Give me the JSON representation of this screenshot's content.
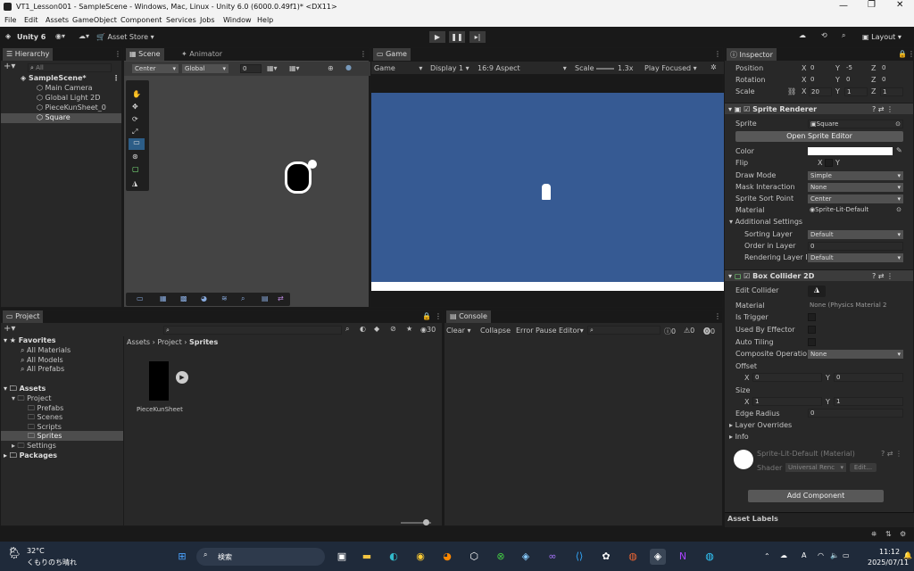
{
  "window": {
    "title": "VT1_Lesson001 - SampleScene - Windows, Mac, Linux - Unity 6.0 (6000.0.49f1)* <DX11>"
  },
  "menu": [
    "File",
    "Edit",
    "Assets",
    "GameObject",
    "Component",
    "Services",
    "Jobs",
    "Window",
    "Help"
  ],
  "toolbar": {
    "account": "Unity 6",
    "asset_store": "Asset Store",
    "layout": "Layout"
  },
  "hierarchy": {
    "tab": "Hierarchy",
    "search_placeholder": "All",
    "scene": "SampleScene*",
    "items": [
      "Main Camera",
      "Global Light 2D",
      "PieceKunSheet_0",
      "Square"
    ]
  },
  "scene": {
    "tab_scene": "Scene",
    "tab_animator": "Animator",
    "pivot": "Center",
    "space": "Global",
    "snap": "0"
  },
  "game": {
    "tab": "Game",
    "mode": "Game",
    "display": "Display 1",
    "aspect": "16:9 Aspect",
    "scale_label": "Scale",
    "scale_value": "1.3x",
    "play_mode": "Play Focused"
  },
  "inspector": {
    "tab": "Inspector",
    "transform": {
      "position": {
        "label": "Position",
        "x": "0",
        "y": "-5",
        "z": "0"
      },
      "rotation": {
        "label": "Rotation",
        "x": "0",
        "y": "0",
        "z": "0"
      },
      "scale": {
        "label": "Scale",
        "x": "20",
        "y": "1",
        "z": "1"
      }
    },
    "sprite_renderer": {
      "title": "Sprite Renderer",
      "sprite_label": "Sprite",
      "sprite_value": "Square",
      "open_editor": "Open Sprite Editor",
      "color_label": "Color",
      "flip_label": "Flip",
      "flip_x": "X",
      "flip_y": "Y",
      "draw_mode_label": "Draw Mode",
      "draw_mode": "Simple",
      "mask_label": "Mask Interaction",
      "mask": "None",
      "sort_point_label": "Sprite Sort Point",
      "sort_point": "Center",
      "material_label": "Material",
      "material": "Sprite-Lit-Default",
      "additional": "Additional Settings",
      "sorting_layer_label": "Sorting Layer",
      "sorting_layer": "Default",
      "order_label": "Order in Layer",
      "order": "0",
      "rendering_layer_label": "Rendering Layer M",
      "rendering_layer": "Default"
    },
    "box_collider": {
      "title": "Box Collider 2D",
      "edit_label": "Edit Collider",
      "material_label": "Material",
      "material": "None (Physics Material 2",
      "trigger": "Is Trigger",
      "effector": "Used By Effector",
      "tiling": "Auto Tiling",
      "composite_label": "Composite Operatior",
      "composite": "None",
      "offset_label": "Offset",
      "offset_x": "0",
      "offset_y": "0",
      "size_label": "Size",
      "size_x": "1",
      "size_y": "1",
      "edge_label": "Edge Radius",
      "edge": "0",
      "layer_overrides": "Layer Overrides",
      "info": "Info"
    },
    "material": {
      "name": "Sprite-Lit-Default (Material)",
      "shader_label": "Shader",
      "shader": "Universal Renc",
      "edit": "Edit..."
    },
    "add_component": "Add Component",
    "asset_labels": "Asset Labels"
  },
  "project": {
    "tab": "Project",
    "favorites": "Favorites",
    "fav_items": [
      "All Materials",
      "All Models",
      "All Prefabs"
    ],
    "assets": "Assets",
    "project_folder": "Project",
    "sub": [
      "Prefabs",
      "Scenes",
      "Scripts",
      "Sprites"
    ],
    "settings": "Settings",
    "packages": "Packages",
    "breadcrumb": [
      "Assets",
      "Project",
      "Sprites"
    ],
    "asset_name": "PieceKunSheet",
    "count": "30"
  },
  "console": {
    "tab": "Console",
    "clear": "Clear",
    "collapse": "Collapse",
    "error_pause": "Error Pause",
    "editor": "Editor",
    "c1": "0",
    "c2": "0",
    "c3": "0"
  },
  "taskbar": {
    "temp": "32°C",
    "weather": "くもりのち晴れ",
    "search": "検索",
    "ime": "A",
    "time": "11:12",
    "date": "2025/07/11"
  },
  "colors": {
    "game_bg": "#365a93",
    "accent": "#2c5d87"
  }
}
